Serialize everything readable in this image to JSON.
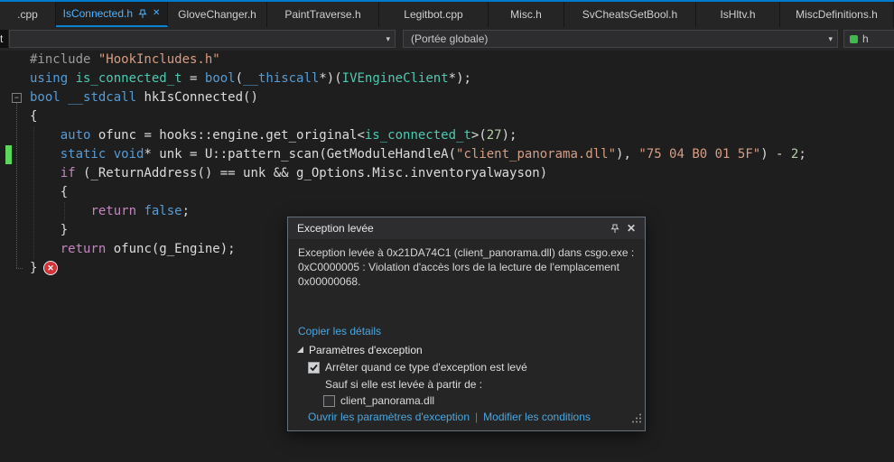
{
  "window": {
    "accent_color": "#007acc"
  },
  "tabbar": {
    "tabs": [
      {
        "label": ".cpp",
        "active": false
      },
      {
        "label": "IsConnected.h",
        "active": true
      },
      {
        "label": "GloveChanger.h",
        "active": false
      },
      {
        "label": "PaintTraverse.h",
        "active": false
      },
      {
        "label": "Legitbot.cpp",
        "active": false
      },
      {
        "label": "Misc.h",
        "active": false
      },
      {
        "label": "SvCheatsGetBool.h",
        "active": false
      },
      {
        "label": "IsHltv.h",
        "active": false
      },
      {
        "label": "MiscDefinitions.h",
        "active": false
      }
    ]
  },
  "navbar": {
    "left_fragment": "t",
    "scope_dropdown": "(Portée globale)",
    "member_dropdown": "h"
  },
  "editor": {
    "token_colors": {
      "pre": "#9b9b9b",
      "kw": "#569cd6",
      "ctrl": "#c586c0",
      "type": "#4ec9b0",
      "str": "#d69d85",
      "num": "#b5cea8",
      "txt": "#dcdcdc"
    },
    "change_bar_color": "#5bd75b",
    "error_icon_color": "#d13438",
    "lines": [
      [
        {
          "t": "#include ",
          "c": "pre"
        },
        {
          "t": "\"HookIncludes.h\"",
          "c": "str"
        }
      ],
      [
        {
          "t": "using ",
          "c": "kw"
        },
        {
          "t": "is_connected_t",
          "c": "type"
        },
        {
          "t": " = ",
          "c": "txt"
        },
        {
          "t": "bool",
          "c": "kw"
        },
        {
          "t": "(",
          "c": "txt"
        },
        {
          "t": "__thiscall",
          "c": "kw"
        },
        {
          "t": "*)(",
          "c": "txt"
        },
        {
          "t": "IVEngineClient",
          "c": "type"
        },
        {
          "t": "*);",
          "c": "txt"
        }
      ],
      [
        {
          "t": "bool",
          "c": "kw"
        },
        {
          "t": " ",
          "c": "txt"
        },
        {
          "t": "__stdcall",
          "c": "kw"
        },
        {
          "t": " hkIsConnected()",
          "c": "txt"
        }
      ],
      [
        {
          "t": "{",
          "c": "txt"
        }
      ],
      [
        {
          "t": "    ",
          "c": "txt"
        },
        {
          "t": "auto",
          "c": "kw"
        },
        {
          "t": " ofunc = hooks::engine.get_original<",
          "c": "txt"
        },
        {
          "t": "is_connected_t",
          "c": "type"
        },
        {
          "t": ">(",
          "c": "txt"
        },
        {
          "t": "27",
          "c": "num"
        },
        {
          "t": ");",
          "c": "txt"
        }
      ],
      [
        {
          "t": "    ",
          "c": "txt"
        },
        {
          "t": "static",
          "c": "kw"
        },
        {
          "t": " ",
          "c": "txt"
        },
        {
          "t": "void",
          "c": "kw"
        },
        {
          "t": "* unk = U::pattern_scan(GetModuleHandleA(",
          "c": "txt"
        },
        {
          "t": "\"client_panorama.dll\"",
          "c": "str"
        },
        {
          "t": "), ",
          "c": "txt"
        },
        {
          "t": "\"75 04 B0 01 5F\"",
          "c": "str"
        },
        {
          "t": ") - ",
          "c": "txt"
        },
        {
          "t": "2",
          "c": "num"
        },
        {
          "t": ";",
          "c": "txt"
        }
      ],
      [
        {
          "t": "    ",
          "c": "txt"
        },
        {
          "t": "if",
          "c": "ctrl"
        },
        {
          "t": " (_ReturnAddress() == unk && g_Options.Misc.inventoryalwayson)",
          "c": "txt"
        }
      ],
      [
        {
          "t": "    {",
          "c": "txt"
        }
      ],
      [
        {
          "t": "        ",
          "c": "txt"
        },
        {
          "t": "return",
          "c": "ctrl"
        },
        {
          "t": " ",
          "c": "txt"
        },
        {
          "t": "false",
          "c": "kw"
        },
        {
          "t": ";",
          "c": "txt"
        }
      ],
      [
        {
          "t": "    }",
          "c": "txt"
        }
      ],
      [
        {
          "t": "    ",
          "c": "txt"
        },
        {
          "t": "return",
          "c": "ctrl"
        },
        {
          "t": " ofunc(g_Engine);",
          "c": "txt"
        }
      ],
      [
        {
          "t": "}",
          "c": "txt"
        }
      ]
    ]
  },
  "dialog": {
    "title": "Exception levée",
    "message_lines": [
      "Exception levée à 0x21DA74C1 (client_panorama.dll) dans csgo.exe :",
      "0xC0000005 : Violation d'accès lors de la lecture de l'emplacement",
      "0x00000068."
    ],
    "copy_link": "Copier les détails",
    "expander_label": "Paramètres d'exception",
    "break_label": "Arrêter quand ce type d'exception est levé",
    "break_checked": true,
    "except_label": "Sauf si elle est levée à partir de :",
    "module_label": "client_panorama.dll",
    "module_checked": false,
    "open_settings_link": "Ouvrir les paramètres d'exception",
    "modify_conditions_link": "Modifier les conditions",
    "link_color": "#4aa7e0"
  }
}
